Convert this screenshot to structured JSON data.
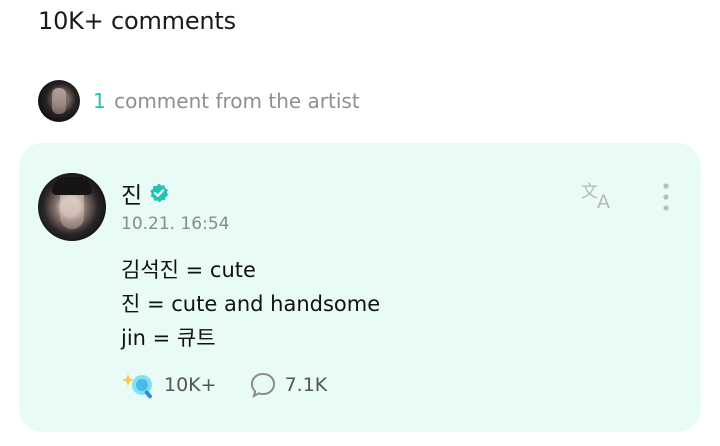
{
  "header": {
    "title": "10K+ comments"
  },
  "artist_summary": {
    "count": "1",
    "label": "comment from the artist"
  },
  "comment": {
    "author": "진",
    "date": "10.21. 16:54",
    "lines": [
      "김석진 = cute",
      "진 = cute and handsome",
      "jin = 큐트"
    ],
    "like_count": "10K+",
    "reply_count": "7.1K"
  },
  "colors": {
    "accent": "#24c1b4",
    "card_bg": "#e8fbf7",
    "muted_text": "#8f8f8f"
  },
  "icons": [
    "verified-badge-icon",
    "translate-icon",
    "more-vertical-icon",
    "like-icon",
    "reply-icon"
  ]
}
